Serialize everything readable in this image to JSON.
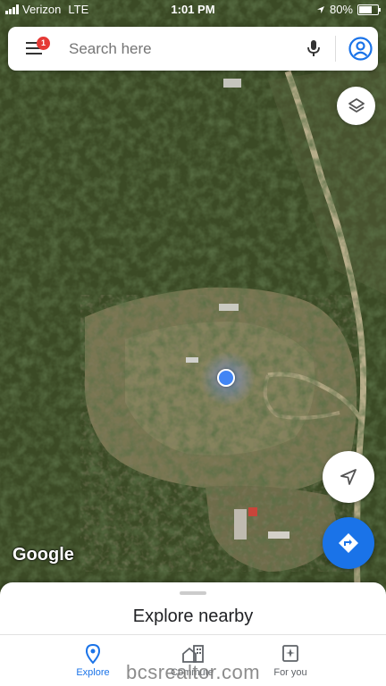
{
  "status_bar": {
    "carrier": "Verizon",
    "network": "LTE",
    "time": "1:01 PM",
    "battery": "80%",
    "battery_level": 0.8
  },
  "search": {
    "placeholder": "Search here",
    "notification_count": "1",
    "icons": [
      "menu-icon",
      "mic-icon",
      "account-icon"
    ]
  },
  "map": {
    "attribution": "Google",
    "map_type": "satellite"
  },
  "buttons": {
    "layers": "layers-icon",
    "my_location": "navigation-arrow-icon",
    "directions": "directions-icon"
  },
  "sheet": {
    "title": "Explore nearby"
  },
  "nav": {
    "items": [
      {
        "label": "Explore",
        "icon": "explore-pin-icon",
        "active": true
      },
      {
        "label": "Commute",
        "icon": "commute-icon",
        "active": false
      },
      {
        "label": "For you",
        "icon": "for-you-icon",
        "active": false
      }
    ]
  },
  "watermark": "bcsrealtor.com",
  "colors": {
    "accent": "#1a73e8",
    "location_dot": "#4285f4",
    "badge": "#e53935"
  }
}
